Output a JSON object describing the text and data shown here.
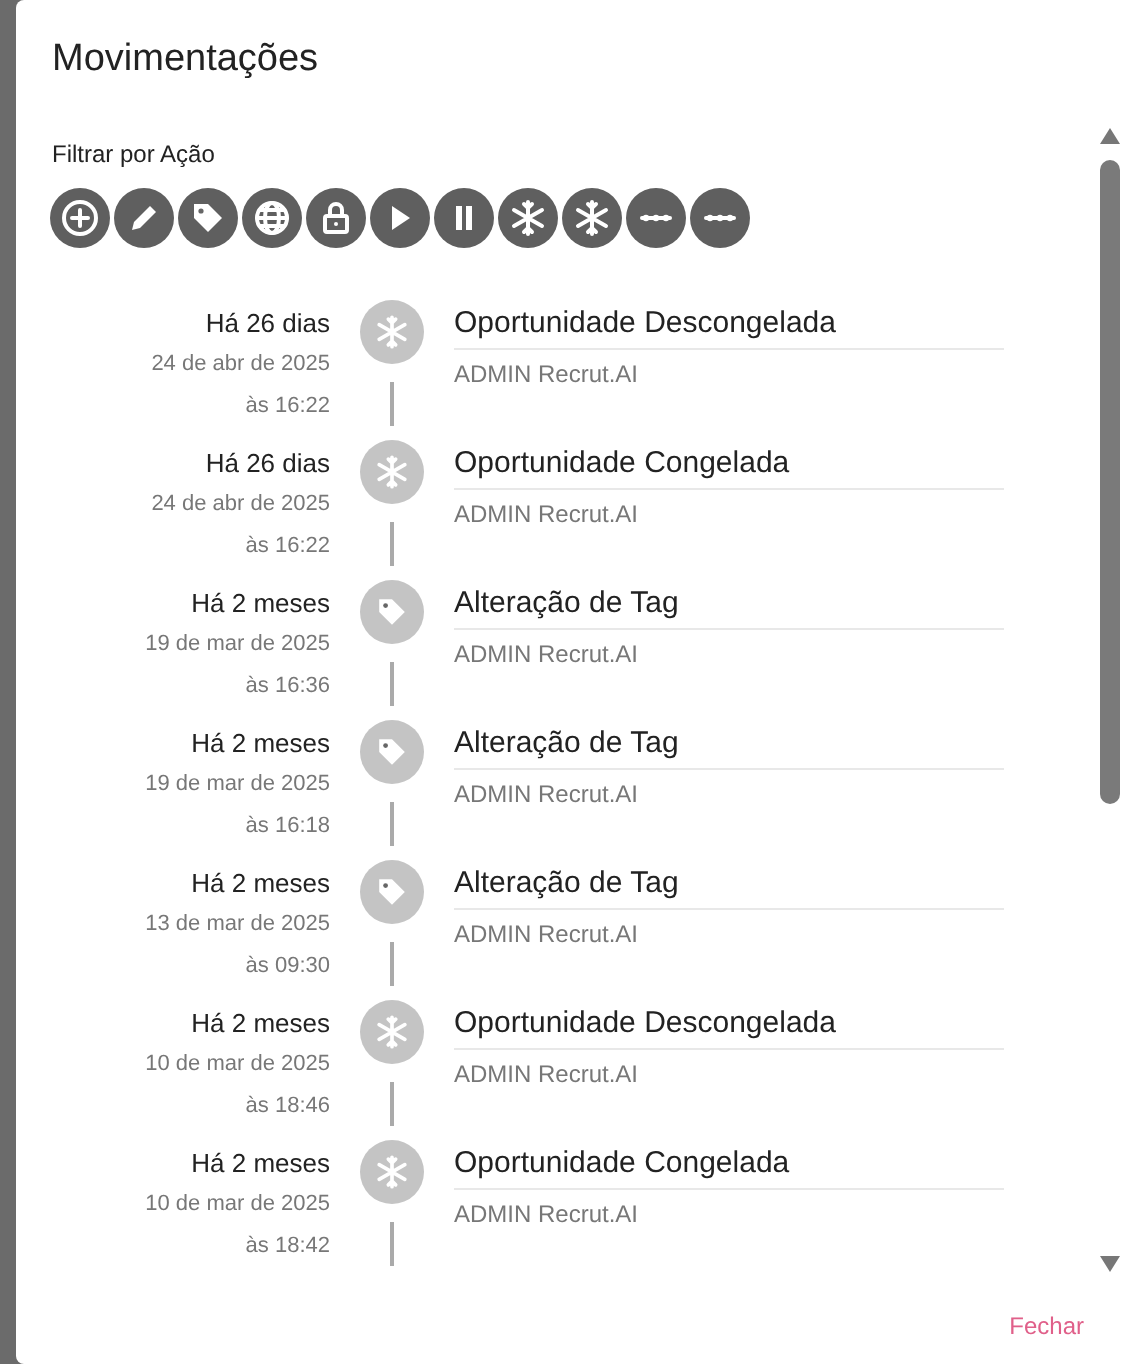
{
  "dialog": {
    "title": "Movimentações"
  },
  "filter": {
    "label": "Filtrar por Ação",
    "buttons": [
      {
        "kind": "add"
      },
      {
        "kind": "edit"
      },
      {
        "kind": "tag"
      },
      {
        "kind": "globe"
      },
      {
        "kind": "lock"
      },
      {
        "kind": "play"
      },
      {
        "kind": "pause"
      },
      {
        "kind": "snowflake"
      },
      {
        "kind": "snowflake"
      },
      {
        "kind": "dots"
      },
      {
        "kind": "dots"
      }
    ]
  },
  "timeline": [
    {
      "kind": "snowflake",
      "relative": "Há 26 dias",
      "date": "24 de abr de 2025",
      "time": "às 16:22",
      "title": "Oportunidade Descongelada",
      "author": "ADMIN Recrut.AI"
    },
    {
      "kind": "snowflake",
      "relative": "Há 26 dias",
      "date": "24 de abr de 2025",
      "time": "às 16:22",
      "title": "Oportunidade Congelada",
      "author": "ADMIN Recrut.AI"
    },
    {
      "kind": "tag",
      "relative": "Há 2 meses",
      "date": "19 de mar de 2025",
      "time": "às 16:36",
      "title": "Alteração de Tag",
      "author": "ADMIN Recrut.AI"
    },
    {
      "kind": "tag",
      "relative": "Há 2 meses",
      "date": "19 de mar de 2025",
      "time": "às 16:18",
      "title": "Alteração de Tag",
      "author": "ADMIN Recrut.AI"
    },
    {
      "kind": "tag",
      "relative": "Há 2 meses",
      "date": "13 de mar de 2025",
      "time": "às 09:30",
      "title": "Alteração de Tag",
      "author": "ADMIN Recrut.AI"
    },
    {
      "kind": "snowflake",
      "relative": "Há 2 meses",
      "date": "10 de mar de 2025",
      "time": "às 18:46",
      "title": "Oportunidade Descongelada",
      "author": "ADMIN Recrut.AI"
    },
    {
      "kind": "snowflake",
      "relative": "Há 2 meses",
      "date": "10 de mar de 2025",
      "time": "às 18:42",
      "title": "Oportunidade Congelada",
      "author": "ADMIN Recrut.AI"
    }
  ],
  "actions": [
    {
      "label": "Fechar"
    }
  ]
}
